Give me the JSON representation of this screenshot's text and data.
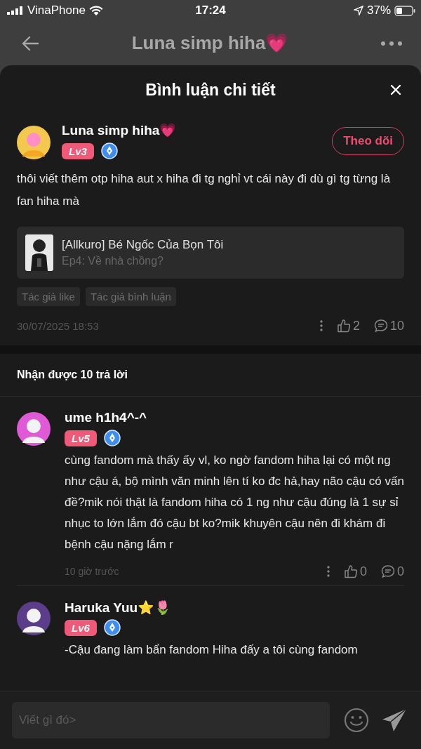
{
  "status_bar": {
    "carrier": "VinaPhone",
    "time": "17:24",
    "battery": "37%"
  },
  "header": {
    "title": "Luna simp hiha💗"
  },
  "sheet": {
    "title": "Bình luận chi tiết"
  },
  "comment": {
    "author": "Luna simp hiha💗",
    "level": "Lv3",
    "follow_button": "Theo dõi",
    "text": "thôi viết thêm otp hiha aut x hiha đi tg nghỉ vt cái này đi dù gì tg từng là fan hiha mà",
    "work": {
      "kind": "picture",
      "title": "[Allkuro] Bé Ngốc Của Bọn Tôi",
      "episode": "Ep4: Về nhà chồng?"
    },
    "tags": [
      "Tác giả like",
      "Tác giả bình luận"
    ],
    "date": "30/07/2025 18:53",
    "likes": "2",
    "replies": "10"
  },
  "replies_heading": "Nhận được 10 trả lời",
  "replies": [
    {
      "name": "ume h1h4^-^",
      "level": "Lv5",
      "text": "cùng fandom mà thấy ấy vl, ko ngờ fandom hiha lại có một ng như cậu á, bộ mình văn minh lên tí ko đc hả,hay não cậu có vấn đề?mik nói thật là fandom hiha có 1 ng như cậu đúng là 1 sự sỉ nhục to lớn lắm đó cậu bt ko?mik khuyên cậu nên đi khám đi bệnh cậu nặng lắm r",
      "time": "10 giờ trước",
      "likes": "0",
      "comments": "0"
    },
    {
      "name": "Haruka Yuu⭐🌷",
      "level": "Lv6",
      "text": "-Cậu đang làm bẩn fandom Hiha đấy a tôi cùng fandom"
    }
  ],
  "input": {
    "placeholder": "Viết gì đó>"
  }
}
